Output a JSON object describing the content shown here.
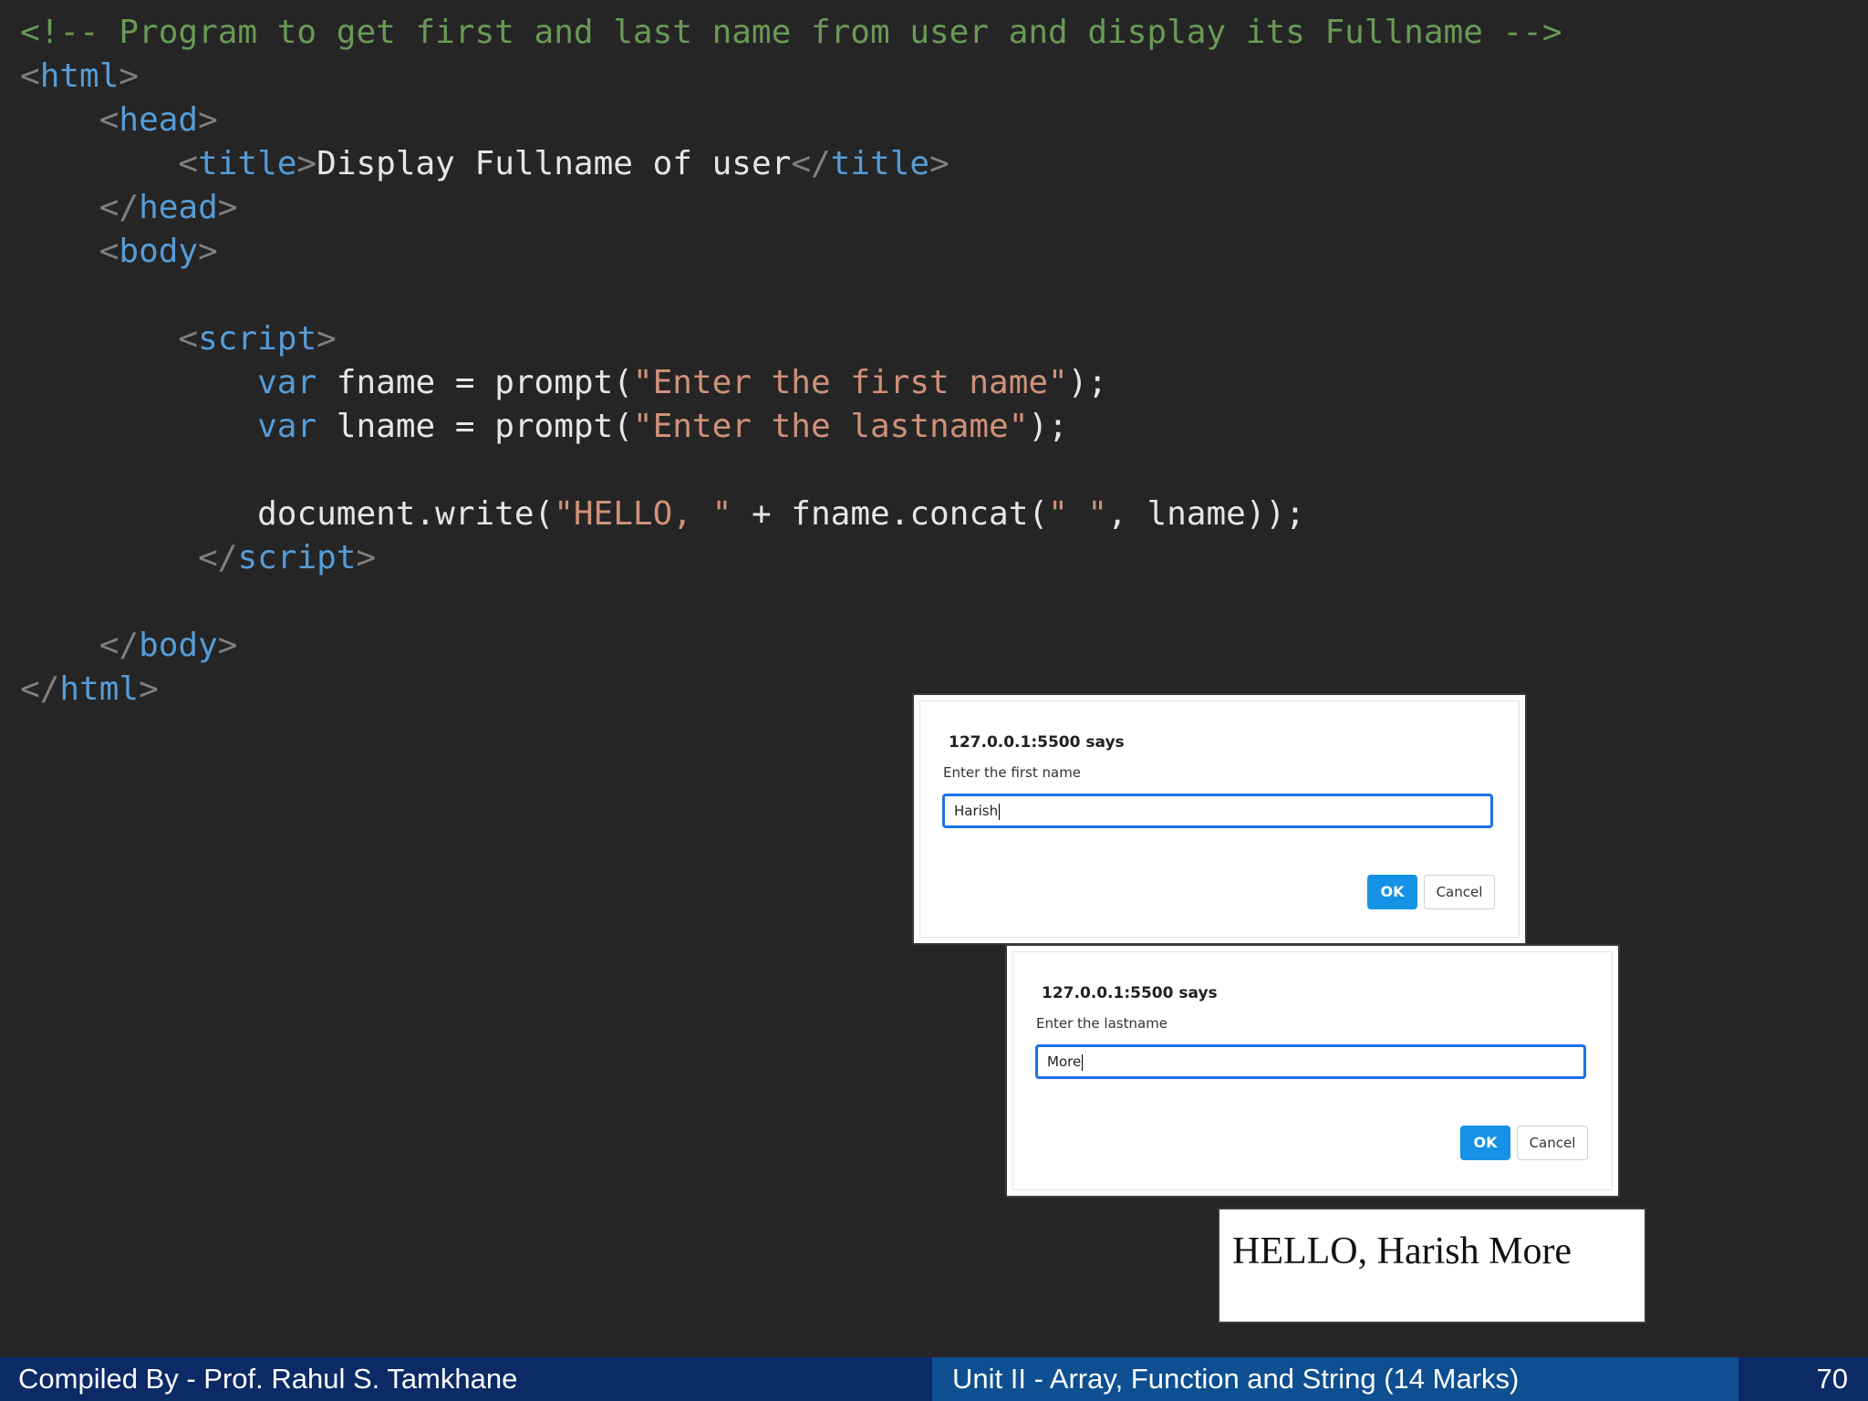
{
  "code_lines": {
    "l1": {
      "comment": "<!-- Program to get first and last name from user and display its Fullname -->"
    },
    "l2": {
      "tag": "html"
    },
    "l3": {
      "tag": "head"
    },
    "l4": {
      "tag_open": "title",
      "text": "Display Fullname of user",
      "tag_close": "title"
    },
    "l5": {
      "tag": "head"
    },
    "l6": {
      "tag": "body"
    },
    "l8": {
      "tag": "script"
    },
    "l9": {
      "keyword": "var",
      "text_before": " fname = prompt(",
      "string": "\"Enter the first name\"",
      "text_after": ");"
    },
    "l10": {
      "keyword": "var",
      "text_before": " lname = prompt(",
      "string": "\"Enter the lastname\"",
      "text_after": ");"
    },
    "l12": {
      "text_before": "document.write(",
      "string1": "\"HELLO, \"",
      "text_mid": " + fname.concat(",
      "string2": "\" \"",
      "text_after": ", lname));"
    },
    "l13": {
      "tag": "script"
    },
    "l15": {
      "tag": "body"
    },
    "l16": {
      "tag": "html"
    }
  },
  "dialog1": {
    "title": "127.0.0.1:5500 says",
    "message": "Enter the first name",
    "input_value": "Harish",
    "ok_label": "OK",
    "cancel_label": "Cancel"
  },
  "dialog2": {
    "title": "127.0.0.1:5500 says",
    "message": "Enter the lastname",
    "input_value": "More",
    "ok_label": "OK",
    "cancel_label": "Cancel"
  },
  "result": {
    "text": "HELLO, Harish More"
  },
  "footer": {
    "left": "Compiled By - Prof. Rahul S. Tamkhane",
    "middle": "Unit II - Array, Function and String (14 Marks)",
    "page_number": "70"
  },
  "colors": {
    "background": "#252526",
    "comment": "#6a9955",
    "tag": "#569cd6",
    "string": "#ce9178",
    "ok_button": "#1592e6",
    "footer_dark": "#0b2a66",
    "footer_mid": "#0d4f91"
  }
}
